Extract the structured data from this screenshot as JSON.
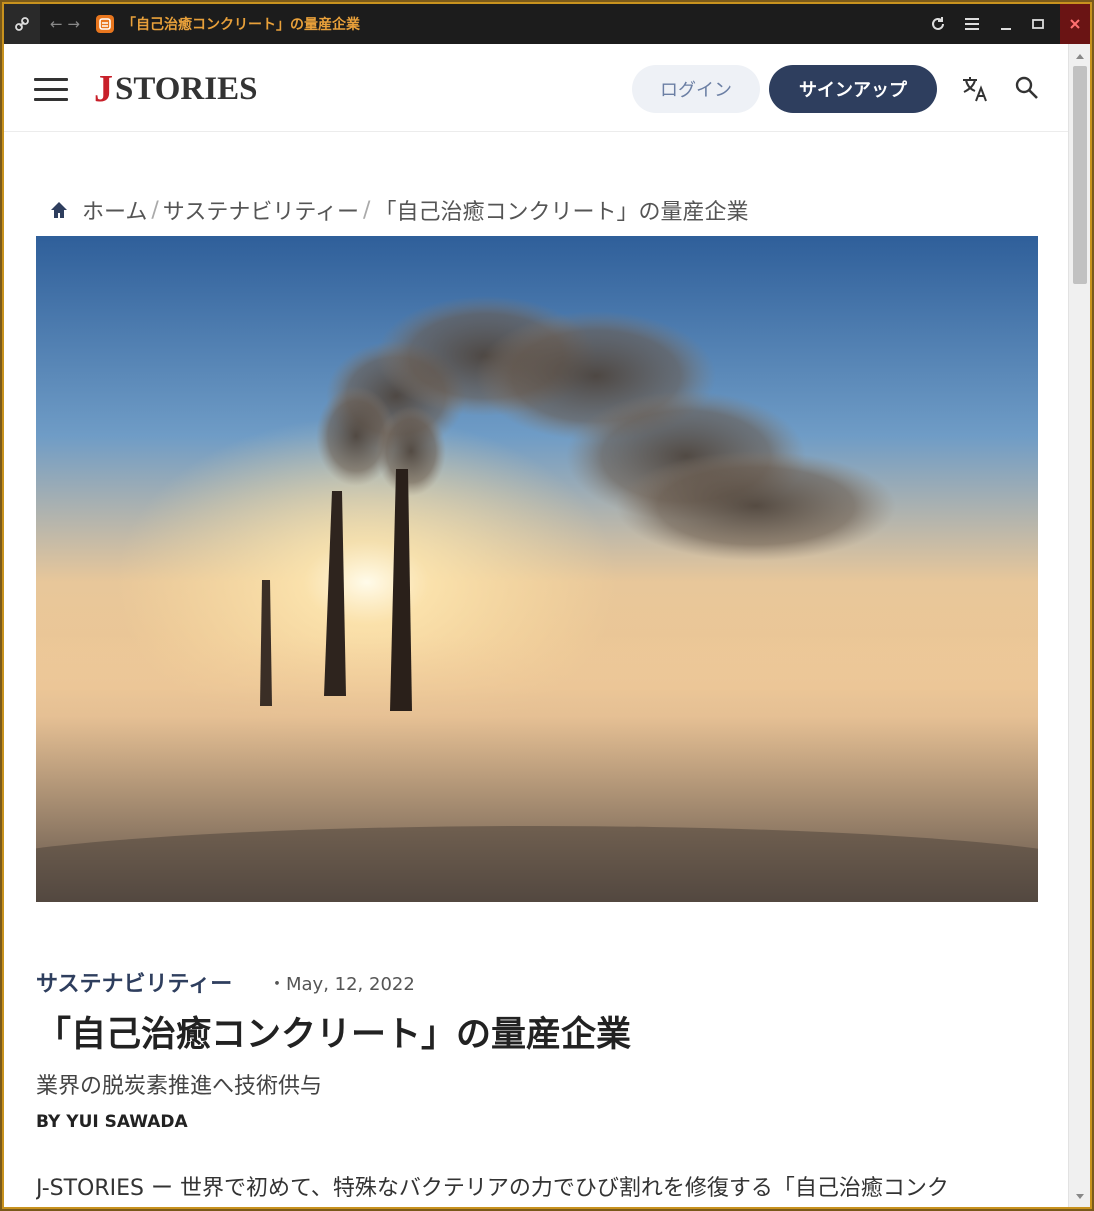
{
  "browser": {
    "tab_title": "「自己治癒コンクリート」の量産企業"
  },
  "header": {
    "logo_j": "J",
    "logo_text": "STORIES",
    "login_label": "ログイン",
    "signup_label": "サインアップ"
  },
  "breadcrumb": {
    "home": "ホーム",
    "separator": "/",
    "category": "サステナビリティー",
    "current": "「自己治癒コンクリート」の量産企業"
  },
  "article": {
    "category": "サステナビリティー",
    "date": "・May, 12, 2022",
    "title": "「自己治癒コンクリート」の量産企業",
    "subtitle": "業界の脱炭素推進へ技術供与",
    "byline": "BY YUI SAWADA",
    "lead": "J-STORIES ー 世界で初めて、特殊なバクテリアの力でひび割れを修復する「自己治癒コンク"
  },
  "colors": {
    "accent_navy": "#2e3e5e",
    "logo_red": "#c8202a",
    "window_border": "#c8921e",
    "tab_text": "#e8a03a"
  }
}
